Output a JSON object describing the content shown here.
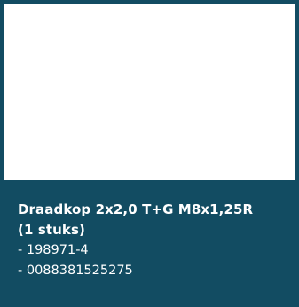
{
  "product": {
    "name_line1": "Draadkop 2x2,0 T+G M8x1,25R",
    "name_line2": "(1 stuks)",
    "article_number": "- 198971-4",
    "ean": "- 0088381525275"
  },
  "colors": {
    "panel_background": "#124c62",
    "text": "#ffffff"
  }
}
